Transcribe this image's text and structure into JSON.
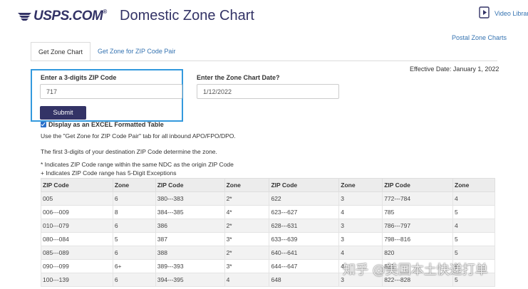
{
  "brand": {
    "logo_text": "USPS.COM",
    "logo_mark": "®",
    "colors": {
      "navy": "#333366",
      "link": "#3573b1",
      "focus": "#3399dd"
    }
  },
  "header": {
    "title": "Domestic Zone Chart",
    "video_link": "Video Library",
    "postal_zone_link": "Postal Zone Charts"
  },
  "tabs": [
    {
      "label": "Get Zone Chart",
      "active": true
    },
    {
      "label": "Get Zone for ZIP Code Pair",
      "active": false
    }
  ],
  "form": {
    "effective_date": "Effective Date: January 1, 2022",
    "zip_label": "Enter a 3-digits ZIP Code",
    "zip_value": "717",
    "date_label": "Enter the Zone Chart Date?",
    "date_value": "1/12/2022",
    "submit_label": "Submit",
    "excel_label": "Display as an EXCEL Formatted Table",
    "excel_checked": true
  },
  "notes": {
    "apo": "Use the \"Get Zone for ZIP Code Pair\" tab for all inbound APO/FPO/DPO.",
    "first3": "The first 3-digits of your destination ZIP Code determine the zone.",
    "star": "* Indicates ZIP Code range within the same NDC as the origin ZIP Code",
    "plus": "+ Indicates ZIP Code range has 5-Digit Exceptions"
  },
  "table": {
    "headers": [
      "ZIP Code",
      "Zone",
      "ZIP Code",
      "Zone",
      "ZIP Code",
      "Zone",
      "ZIP Code",
      "Zone"
    ],
    "rows": [
      [
        "005",
        "6",
        "380---383",
        "2*",
        "622",
        "3",
        "772---784",
        "4"
      ],
      [
        "006---009",
        "8",
        "384---385",
        "4*",
        "623---627",
        "4",
        "785",
        "5"
      ],
      [
        "010---079",
        "6",
        "386",
        "2*",
        "628---631",
        "3",
        "786---797",
        "4"
      ],
      [
        "080---084",
        "5",
        "387",
        "3*",
        "633---639",
        "3",
        "798---816",
        "5"
      ],
      [
        "085---089",
        "6",
        "388",
        "2*",
        "640---641",
        "4",
        "820",
        "5"
      ],
      [
        "090---099",
        "6+",
        "389---393",
        "3*",
        "644---647",
        "4",
        "821",
        "5"
      ],
      [
        "100---139",
        "6",
        "394---395",
        "4",
        "648",
        "3",
        "822---828",
        "5"
      ]
    ]
  },
  "watermark": "知乎 @美国本土快递打单"
}
